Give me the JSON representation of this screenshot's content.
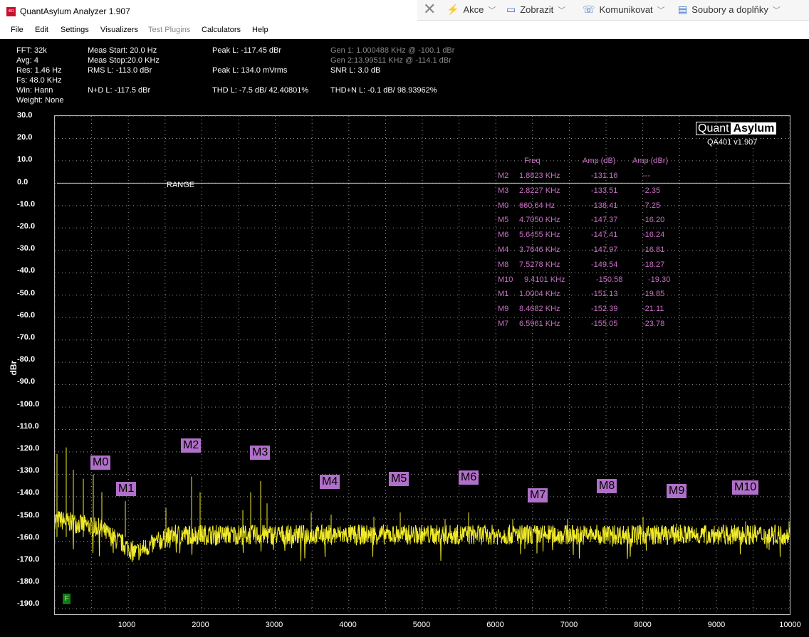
{
  "window": {
    "title": "QuantAsylum Analyzer 1.907",
    "icon_text": "401"
  },
  "toolbar_ext": [
    {
      "label": "Akce",
      "icon": "lightning-icon"
    },
    {
      "label": "Zobrazit",
      "icon": "monitor-icon"
    },
    {
      "label": "Komunikovat",
      "icon": "phone-icon"
    },
    {
      "label": "Soubory a doplňky",
      "icon": "files-icon"
    }
  ],
  "menu": [
    "File",
    "Edit",
    "Settings",
    "Visualizers",
    "Test Plugins",
    "Calculators",
    "Help"
  ],
  "stats": {
    "fft": "FFT: 32k",
    "avg": "Avg: 4",
    "res": "Res: 1.46 Hz",
    "fs": "Fs: 48.0 KHz",
    "win": "Win: Hann",
    "weight": "Weight: None",
    "meas_start": "Meas Start: 20.0 Hz",
    "meas_stop": "Meas Stop:20.0 KHz",
    "rms": "RMS L: -113.0 dBr",
    "nd": "N+D L: -117.5 dBr",
    "peak1": "Peak L: -117.45 dBr",
    "peak2": "Peak L: 134.0 mVrms",
    "thd": "THD L: -7.5 dB/ 42.40801%",
    "gen1": "Gen 1: 1.000488 KHz @ -100.1  dBr",
    "gen2": "Gen 2:13.99511 KHz @ -114.1  dBr",
    "snr": "SNR L: 3.0 dB",
    "thdn": "THD+N L: -0.1 dB/ 98.93962%"
  },
  "plot": {
    "logo_a": "Quant",
    "logo_b": "Asylum",
    "version": "QA401 v1.907",
    "range_label": "RANGE",
    "ylabel": "dBr",
    "f_tag": "F",
    "yticks": [
      "30.0",
      "20.0",
      "10.0",
      "0.0",
      "-10.0",
      "-20.0",
      "-30.0",
      "-40.0",
      "-50.0",
      "-60.0",
      "-70.0",
      "-80.0",
      "-90.0",
      "-100.0",
      "-110.0",
      "-120.0",
      "-130.0",
      "-140.0",
      "-150.0",
      "-160.0",
      "-170.0",
      "-180.0",
      "-190.0"
    ],
    "xticks": [
      "1000",
      "2000",
      "3000",
      "4000",
      "5000",
      "6000",
      "7000",
      "8000",
      "9000",
      "10000"
    ],
    "trace_color": "#f0ea2a",
    "marker_color": "#b06fc8"
  },
  "marker_table": {
    "headers": [
      "Freq",
      "Amp (dB)",
      "Amp (dBr)"
    ],
    "rows": [
      [
        "M2",
        "1.8823 KHz",
        "-131.16",
        "---"
      ],
      [
        "M3",
        "2.8227 KHz",
        "-133.51",
        "-2.35"
      ],
      [
        "M0",
        "660.64 Hz",
        "-138.41",
        "-7.25"
      ],
      [
        "M5",
        "4.7050 KHz",
        "-147.37",
        "-16.20"
      ],
      [
        "M6",
        "5.6455 KHz",
        "-147.41",
        "-16.24"
      ],
      [
        "M4",
        "3.7646 KHz",
        "-147.97",
        "-16.81"
      ],
      [
        "M8",
        "7.5278 KHz",
        "-149.54",
        "-18.27"
      ],
      [
        "M10",
        "9.4101 KHz",
        "-150.58",
        "-19.30"
      ],
      [
        "M1",
        "1.0004 KHz",
        "-151.13",
        "-19.85"
      ],
      [
        "M9",
        "8.4682 KHz",
        "-152.39",
        "-21.11"
      ],
      [
        "M7",
        "6.5961 KHz",
        "-155.05",
        "-23.78"
      ]
    ]
  },
  "markers": [
    "M0",
    "M1",
    "M2",
    "M3",
    "M4",
    "M5",
    "M6",
    "M7",
    "M8",
    "M9",
    "M10"
  ]
}
